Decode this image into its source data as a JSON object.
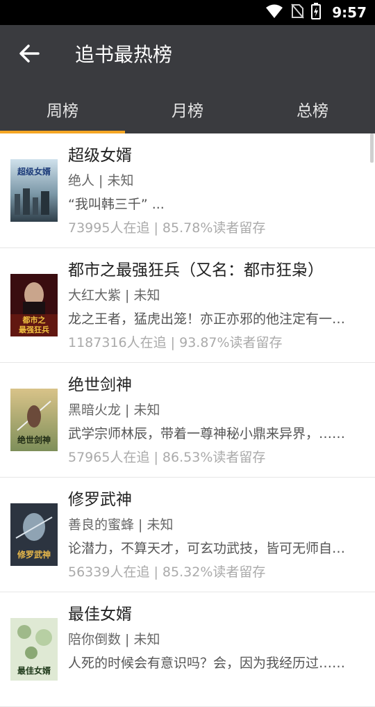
{
  "status_bar": {
    "time": "9:57"
  },
  "toolbar": {
    "title": "追书最热榜",
    "back_icon": "arrow-left-icon"
  },
  "tabs": [
    {
      "label": "周榜",
      "active": true
    },
    {
      "label": "月榜",
      "active": false
    },
    {
      "label": "总榜",
      "active": false
    }
  ],
  "books": [
    {
      "title": "超级女婿",
      "author_line": "绝人 | 未知",
      "description": "“我叫韩三千” ...",
      "stats": "73995人在追 |  85.78%读者留存",
      "cover_text": "超级女婿",
      "cover_sub": "绝人 著"
    },
    {
      "title": "都市之最强狂兵（又名：都市狂枭）",
      "author_line": "大红大紫 | 未知",
      "description": "龙之王者，猛虎出笼！亦正亦邪的他注定有一番不平凡的经历……",
      "stats": "1187316人在追 |  93.87%读者留存",
      "cover_text": "都市之最强狂兵",
      "cover_sub": ""
    },
    {
      "title": "绝世剑神",
      "author_line": "黑暗火龙 | 未知",
      "description": "武学宗师林辰，带着一尊神秘小鼎来异界，……",
      "stats": "57965人在追 |  86.53%读者留存",
      "cover_text": "绝世剑神",
      "cover_sub": "黑暗火龙 著"
    },
    {
      "title": "修罗武神",
      "author_line": "善良的蜜蜂 | 未知",
      "description": "论潜力，不算天才，可玄功武技，皆可无师自通……",
      "stats": "56339人在追 |  85.32%读者留存",
      "cover_text": "修罗武神",
      "cover_sub": ""
    },
    {
      "title": "最佳女婿",
      "author_line": "陪你倒数 | 未知",
      "description": "人死的时候会有意识吗？会，因为我经历过……",
      "stats": "",
      "cover_text": "最佳女婿",
      "cover_sub": ""
    }
  ],
  "colors": {
    "toolbar_bg": "#3a3b3f",
    "tab_indicator": "#f5a623",
    "status_bar_bg": "#000000"
  }
}
